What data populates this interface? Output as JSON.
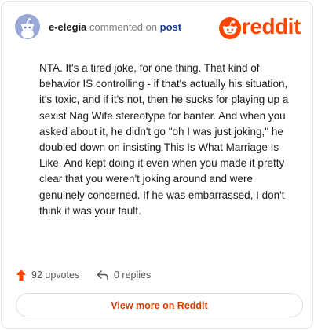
{
  "header": {
    "username": "e-elegia",
    "action_text": "commented on",
    "post_link": "post",
    "logo_text": "reddit"
  },
  "comment": {
    "body": "NTA. It's a tired joke, for one thing. That kind of behavior IS controlling - if that's actually his situation, it's toxic, and if it's not, then he sucks for playing up a sexist Nag Wife stereotype for banter. And when you asked about it, he didn't go \"oh I was just joking,\" he doubled down on insisting This Is What Marriage Is Like. And kept doing it even when you made it pretty clear that you weren't joking around and were genuinely concerned. If he was embarrassed, I don't think it was your fault."
  },
  "actions": {
    "upvotes": "92 upvotes",
    "replies": "0 replies",
    "upvote_icon": "upvote-arrow-icon",
    "reply_icon": "reply-arrow-icon"
  },
  "footer": {
    "view_more": "View more on Reddit"
  },
  "colors": {
    "brand": "#ff4500",
    "link": "#1a3ea8",
    "view_more_text": "#d93a00",
    "avatar_bg": "#9aa8d8"
  }
}
